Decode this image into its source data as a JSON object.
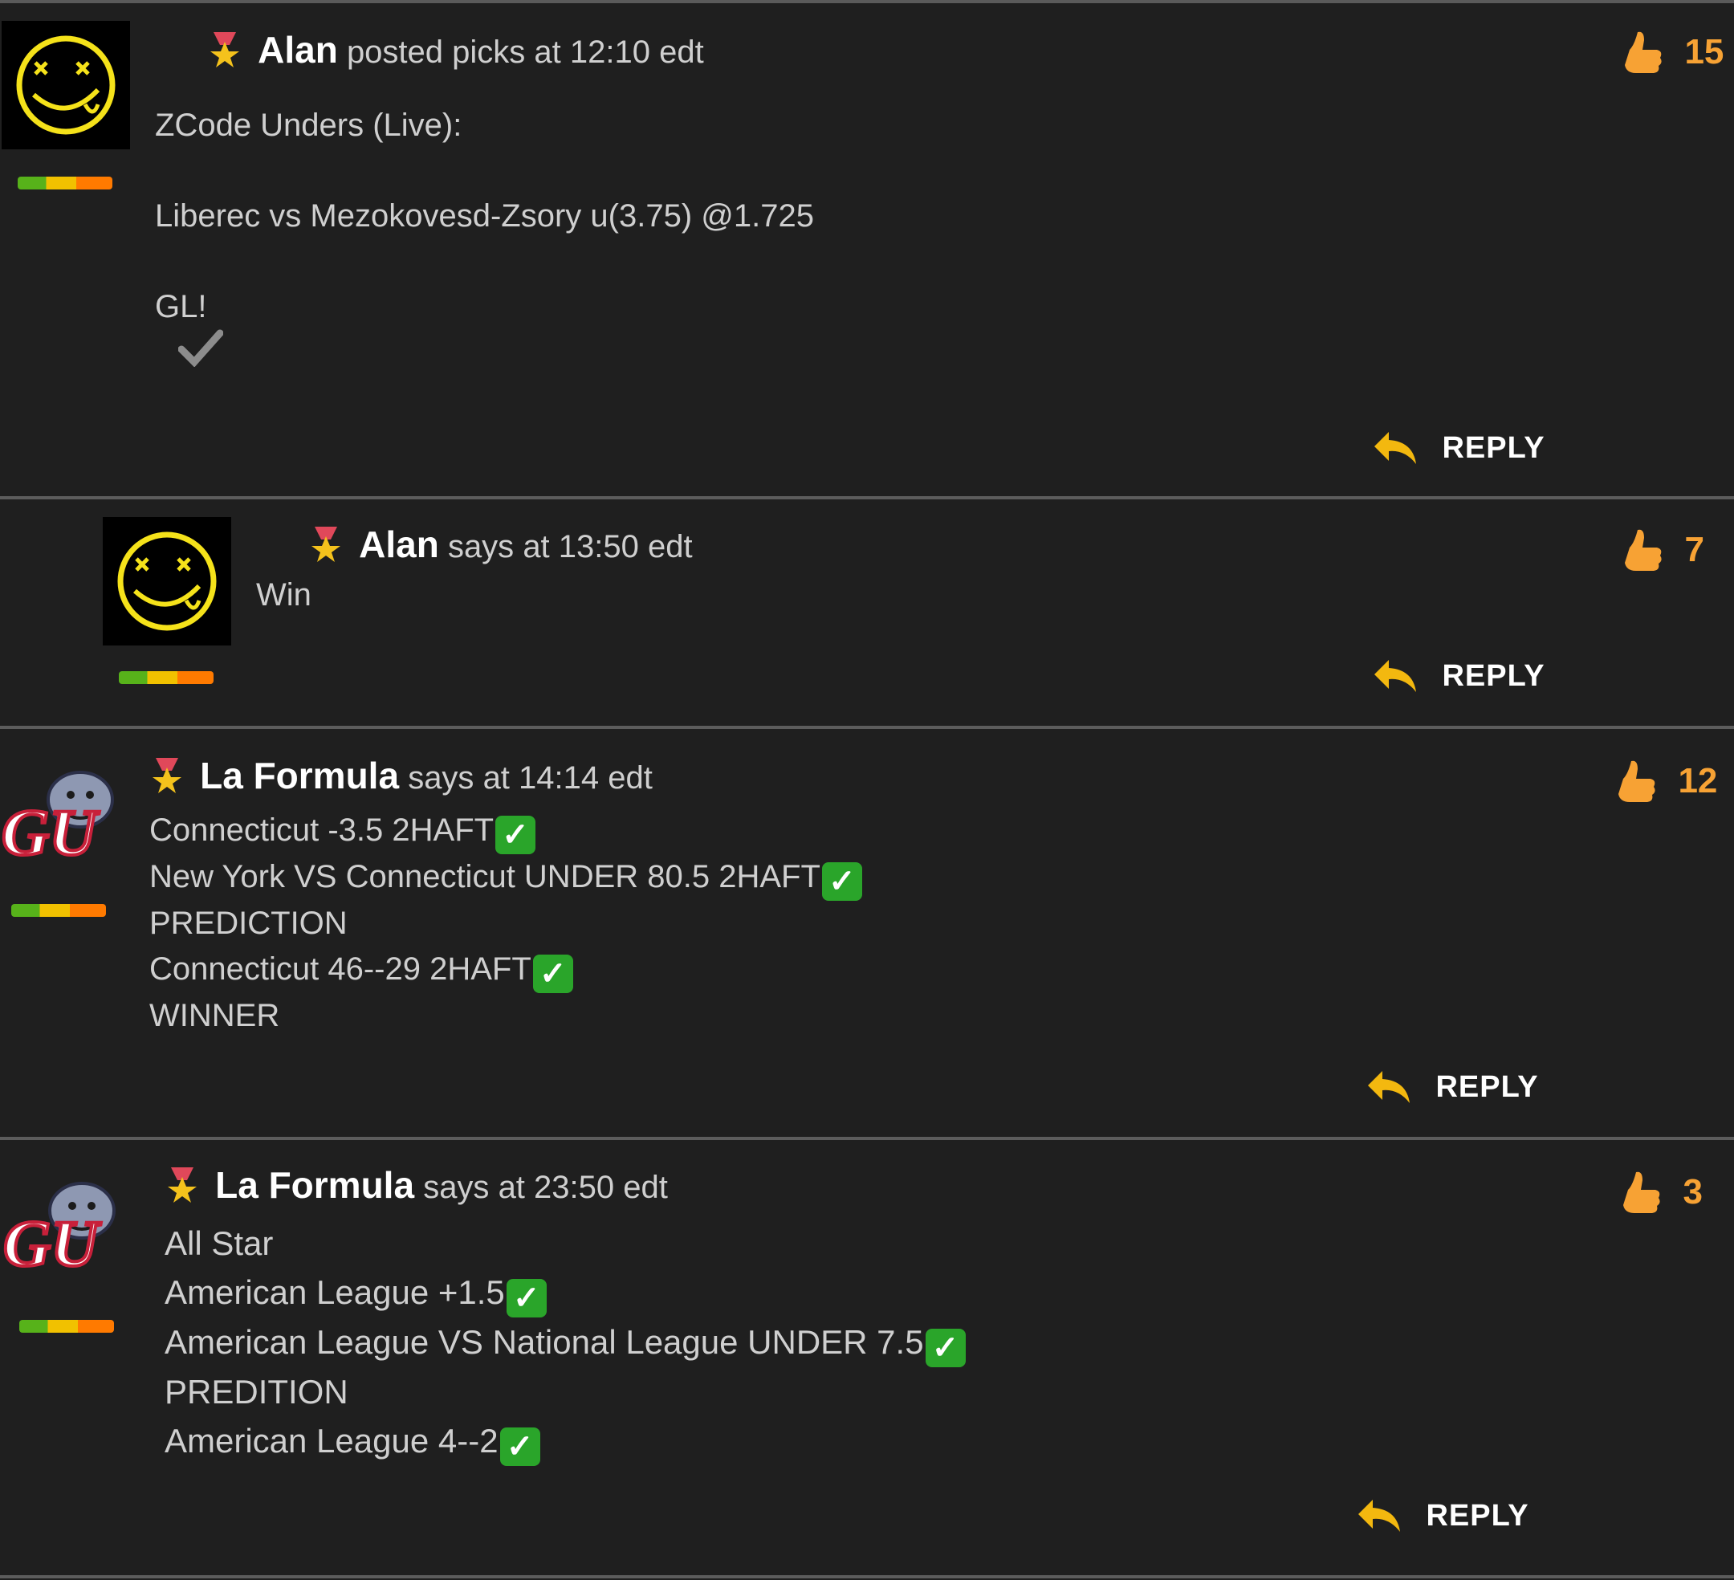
{
  "posts": [
    {
      "author": "Alan",
      "verb": "posted picks",
      "time": "at 12:10 edt",
      "likes": "15",
      "lines": [
        "ZCode Unders (Live):",
        "",
        "Liberec vs Mezokovesd-Zsory u(3.75) @1.725",
        "",
        "GL!"
      ],
      "reply_label": "REPLY",
      "avatar_icon": "smiley-face-icon"
    },
    {
      "author": "Alan",
      "verb": "says",
      "time": "at 13:50 edt",
      "likes": "7",
      "lines": [
        "Win"
      ],
      "reply_label": "REPLY",
      "avatar_icon": "smiley-face-icon"
    },
    {
      "author": "La Formula",
      "verb": "says",
      "time": "at 14:14 edt",
      "likes": "12",
      "lines": [
        "Connecticut -3.5 2HAFT",
        "New York VS Connecticut UNDER 80.5 2HAFT",
        "PREDICTION",
        "Connecticut 46--29 2HAFT",
        "WINNER"
      ],
      "reply_label": "REPLY",
      "avatar_icon": "gu-bulldog-logo"
    },
    {
      "author": "La Formula",
      "verb": "says",
      "time": "at 23:50 edt",
      "likes": "3",
      "lines": [
        "All Star",
        "American League +1.5",
        "American League VS National League UNDER 7.5",
        "PREDITION",
        "American League 4--2"
      ],
      "reply_label": "REPLY",
      "avatar_icon": "gu-bulldog-logo"
    }
  ],
  "avatar_logo_text": "GU",
  "colors": {
    "background": "#1f1f1f",
    "like_count": "#f7a234",
    "reply_arrow": "#f3b80f",
    "check_badge": "#2aa52a"
  }
}
